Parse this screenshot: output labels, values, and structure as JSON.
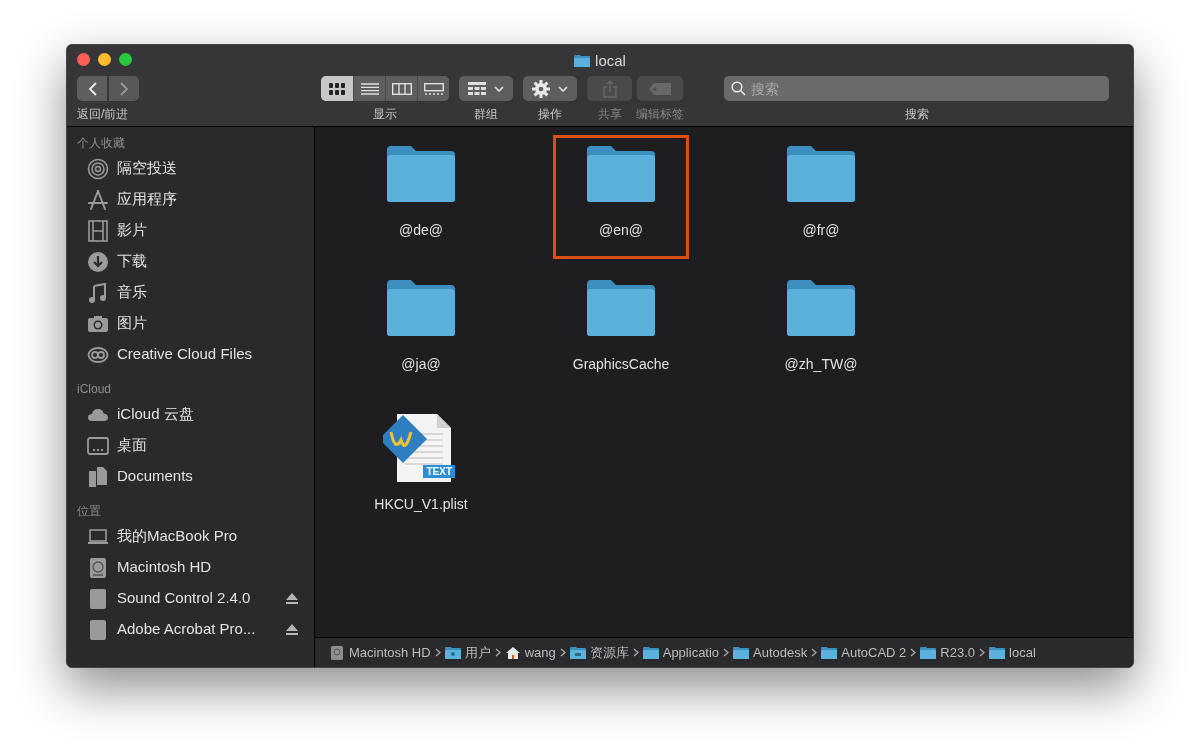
{
  "window": {
    "title": "local"
  },
  "toolbar": {
    "nav_label": "返回/前进",
    "groups": [
      {
        "kind": "view",
        "label": "显示",
        "disabled": false
      },
      {
        "kind": "group",
        "label": "群组",
        "disabled": false
      },
      {
        "kind": "action",
        "label": "操作",
        "disabled": false
      },
      {
        "kind": "share",
        "label": "共享",
        "disabled": true
      },
      {
        "kind": "tag",
        "label": "编辑标签",
        "disabled": true
      }
    ],
    "views": [
      {
        "kind": "icons",
        "selected": true
      },
      {
        "kind": "list",
        "selected": false
      },
      {
        "kind": "columns",
        "selected": false
      },
      {
        "kind": "gallery",
        "selected": false
      }
    ],
    "search": {
      "placeholder": "搜索",
      "label": "搜索"
    }
  },
  "sidebar": {
    "sections": [
      {
        "title": "个人收藏",
        "items": [
          {
            "kind": "airdrop",
            "label": "隔空投送",
            "eject": false
          },
          {
            "kind": "apps",
            "label": "应用程序",
            "eject": false
          },
          {
            "kind": "movies",
            "label": "影片",
            "eject": false
          },
          {
            "kind": "downloads",
            "label": "下载",
            "eject": false
          },
          {
            "kind": "music",
            "label": "音乐",
            "eject": false
          },
          {
            "kind": "pictures",
            "label": "图片",
            "eject": false
          },
          {
            "kind": "cc",
            "label": "Creative Cloud Files",
            "eject": false
          }
        ]
      },
      {
        "title": "iCloud",
        "items": [
          {
            "kind": "cloud",
            "label": "iCloud 云盘",
            "eject": false
          },
          {
            "kind": "desktop",
            "label": "桌面",
            "eject": false
          },
          {
            "kind": "documents",
            "label": "Documents",
            "eject": false
          }
        ]
      },
      {
        "title": "位置",
        "items": [
          {
            "kind": "laptop",
            "label": "我的MacBook Pro",
            "eject": false
          },
          {
            "kind": "hd",
            "label": "Macintosh HD",
            "eject": false
          },
          {
            "kind": "disk",
            "label": "Sound Control 2.4.0",
            "eject": true
          },
          {
            "kind": "disk",
            "label": "Adobe Acrobat Pro...",
            "eject": true
          }
        ]
      }
    ]
  },
  "files": [
    {
      "kind": "folder",
      "name": "@de@",
      "outlined": false
    },
    {
      "kind": "folder",
      "name": "@en@",
      "outlined": true
    },
    {
      "kind": "folder",
      "name": "@fr@",
      "outlined": false
    },
    {
      "kind": "folder",
      "name": "@ja@",
      "outlined": false
    },
    {
      "kind": "folder",
      "name": "GraphicsCache",
      "outlined": false
    },
    {
      "kind": "folder",
      "name": "@zh_TW@",
      "outlined": false
    },
    {
      "kind": "text",
      "name": "HKCU_V1.plist",
      "badge": "TEXT",
      "outlined": false
    }
  ],
  "path_bar": [
    {
      "kind": "hd",
      "label": "Macintosh HD"
    },
    {
      "kind": "users",
      "label": "用户"
    },
    {
      "kind": "home",
      "label": "wang"
    },
    {
      "kind": "library",
      "label": "资源库"
    },
    {
      "kind": "folder",
      "label": "Applicatio"
    },
    {
      "kind": "folder",
      "label": "Autodesk"
    },
    {
      "kind": "folder",
      "label": "AutoCAD 2"
    },
    {
      "kind": "folder",
      "label": "R23.0"
    },
    {
      "kind": "folder",
      "label": "local"
    }
  ]
}
